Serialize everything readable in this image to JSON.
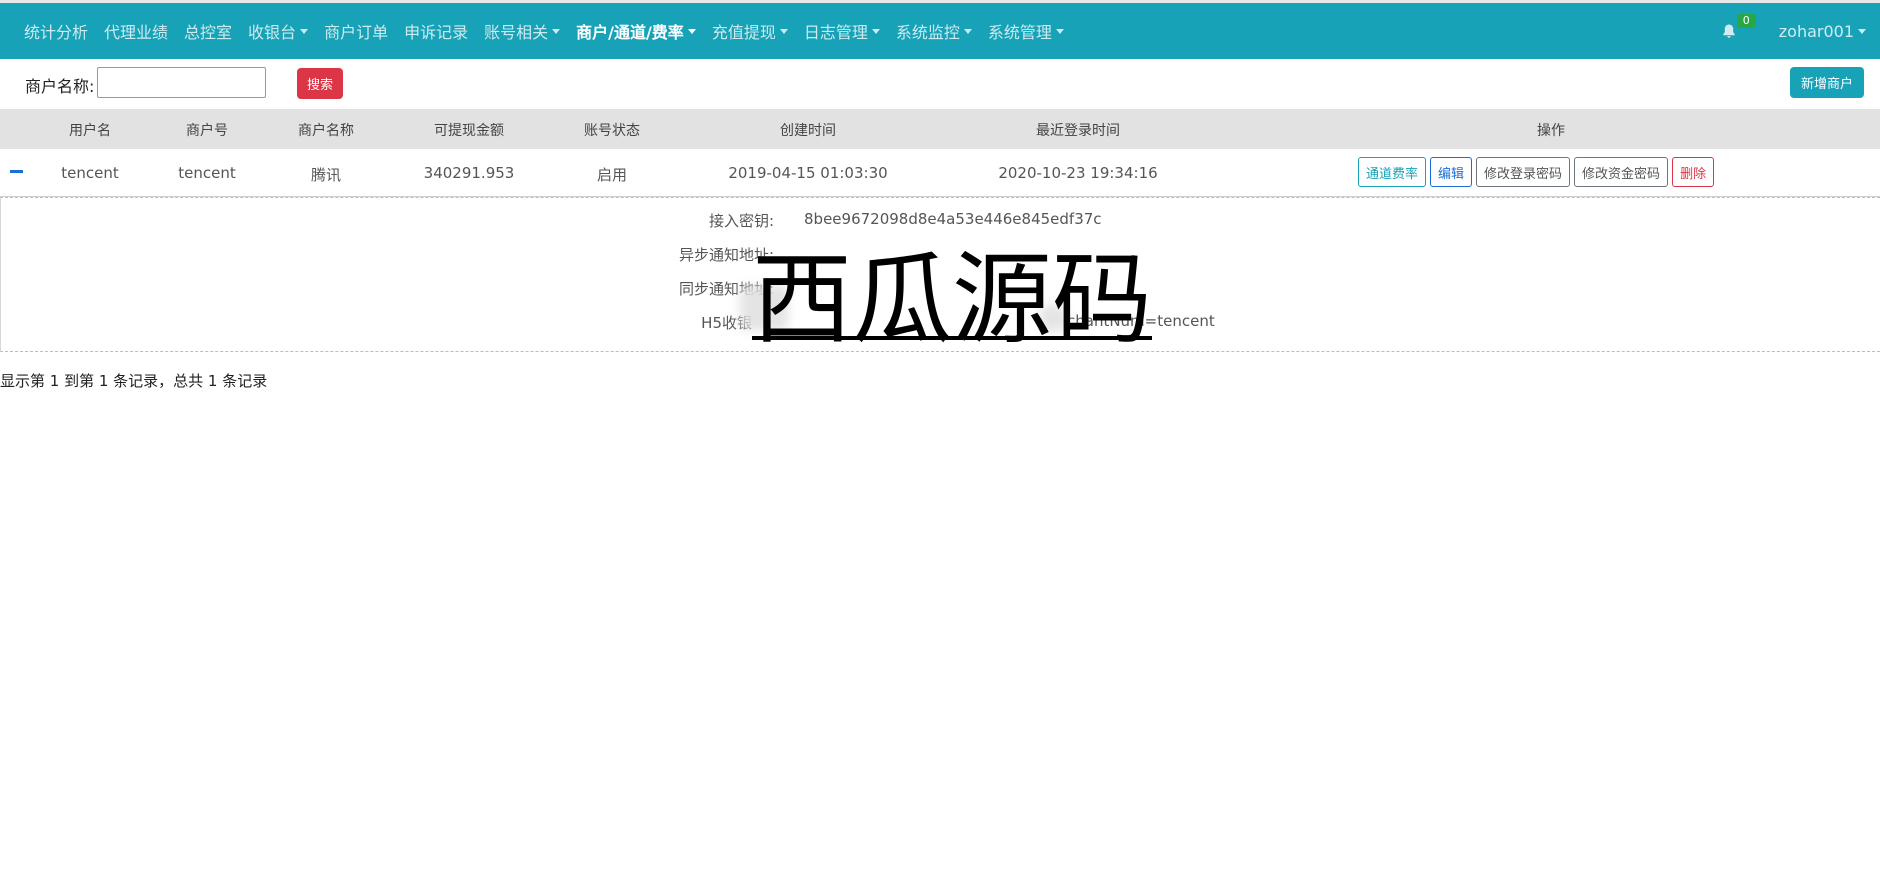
{
  "navbar": {
    "items": [
      {
        "label": "统计分析",
        "dropdown": false,
        "active": false
      },
      {
        "label": "代理业绩",
        "dropdown": false,
        "active": false
      },
      {
        "label": "总控室",
        "dropdown": false,
        "active": false
      },
      {
        "label": "收银台",
        "dropdown": true,
        "active": false
      },
      {
        "label": "商户订单",
        "dropdown": false,
        "active": false
      },
      {
        "label": "申诉记录",
        "dropdown": false,
        "active": false
      },
      {
        "label": "账号相关",
        "dropdown": true,
        "active": false
      },
      {
        "label": "商户/通道/费率",
        "dropdown": true,
        "active": true
      },
      {
        "label": "充值提现",
        "dropdown": true,
        "active": false
      },
      {
        "label": "日志管理",
        "dropdown": true,
        "active": false
      },
      {
        "label": "系统监控",
        "dropdown": true,
        "active": false
      },
      {
        "label": "系统管理",
        "dropdown": true,
        "active": false
      }
    ],
    "notification_count": "0",
    "username": "zohar001"
  },
  "search": {
    "label": "商户名称:",
    "value": "",
    "placeholder": "",
    "button": "搜索"
  },
  "add_button": "新增商户",
  "table": {
    "columns": [
      "用户名",
      "商户号",
      "商户名称",
      "可提现金额",
      "账号状态",
      "创建时间",
      "最近登录时间",
      "操作"
    ],
    "rows": [
      {
        "username": "tencent",
        "merchant_no": "tencent",
        "merchant_name": "腾讯",
        "balance": "340291.953",
        "status": "启用",
        "created": "2019-04-15 01:03:30",
        "last_login": "2020-10-23 19:34:16"
      }
    ],
    "actions": [
      "通道费率",
      "编辑",
      "修改登录密码",
      "修改资金密码",
      "删除"
    ]
  },
  "detail": {
    "fields": [
      {
        "label": "接入密钥:",
        "value": "8bee9672098d8e4a53e446e845edf37c"
      },
      {
        "label": "异步通知地址:",
        "value": ""
      },
      {
        "label": "同步通知地址:",
        "value": ""
      },
      {
        "label": "H5收银",
        "value": "chantNum=tencent"
      }
    ]
  },
  "watermark": "西瓜源码",
  "pagination": "显示第 1 到第 1 条记录，总共 1 条记录",
  "colors": {
    "navbar": "#17a2b8",
    "danger": "#dc3545",
    "primary": "#1a6fd6",
    "badge": "#28a745"
  }
}
